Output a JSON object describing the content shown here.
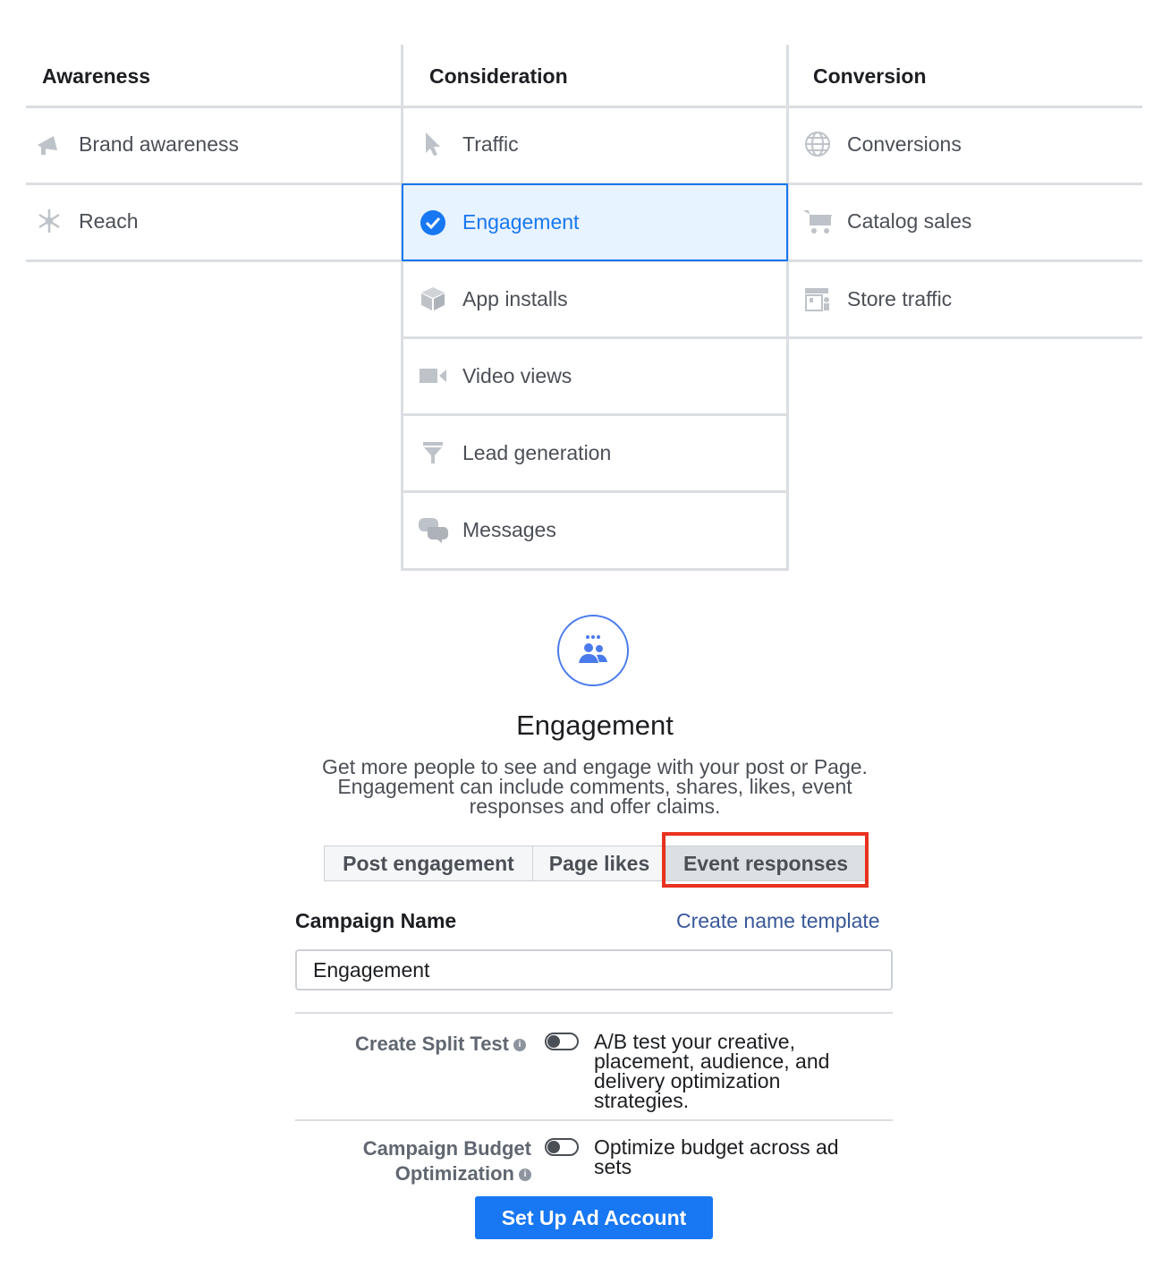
{
  "columns": {
    "awareness": "Awareness",
    "consideration": "Consideration",
    "conversion": "Conversion"
  },
  "awareness_items": [
    {
      "label": "Brand awareness",
      "icon": "megaphone-icon"
    },
    {
      "label": "Reach",
      "icon": "reach-icon"
    }
  ],
  "consideration_items": [
    {
      "label": "Traffic",
      "icon": "cursor-icon"
    },
    {
      "label": "Engagement",
      "icon": "check-circle-icon",
      "selected": true
    },
    {
      "label": "App installs",
      "icon": "box-icon"
    },
    {
      "label": "Video views",
      "icon": "video-camera-icon"
    },
    {
      "label": "Lead generation",
      "icon": "funnel-icon"
    },
    {
      "label": "Messages",
      "icon": "chat-bubbles-icon"
    }
  ],
  "conversion_items": [
    {
      "label": "Conversions",
      "icon": "globe-icon"
    },
    {
      "label": "Catalog sales",
      "icon": "cart-icon"
    },
    {
      "label": "Store traffic",
      "icon": "store-icon"
    }
  ],
  "detail": {
    "icon": "people-icon",
    "title": "Engagement",
    "description_lines": [
      "Get more people to see and engage with your post or Page.",
      "Engagement can include comments, shares, likes, event",
      "responses and offer claims."
    ],
    "tabs": [
      {
        "label": "Post engagement"
      },
      {
        "label": "Page likes"
      },
      {
        "label": "Event responses",
        "active": true
      }
    ]
  },
  "campaign": {
    "name_label": "Campaign Name",
    "template_link": "Create name template",
    "name_value": "Engagement"
  },
  "split_test": {
    "label": "Create Split Test",
    "desc_lines": [
      "A/B test your creative,",
      "placement, audience, and",
      "delivery optimization",
      "strategies."
    ]
  },
  "budget": {
    "label_lines": [
      "Campaign Budget",
      "Optimization"
    ],
    "desc_lines": [
      "Optimize budget across ad",
      "sets"
    ]
  },
  "cta": "Set Up Ad Account",
  "colors": {
    "accent": "#1877f2",
    "highlight": "#e8321f"
  }
}
